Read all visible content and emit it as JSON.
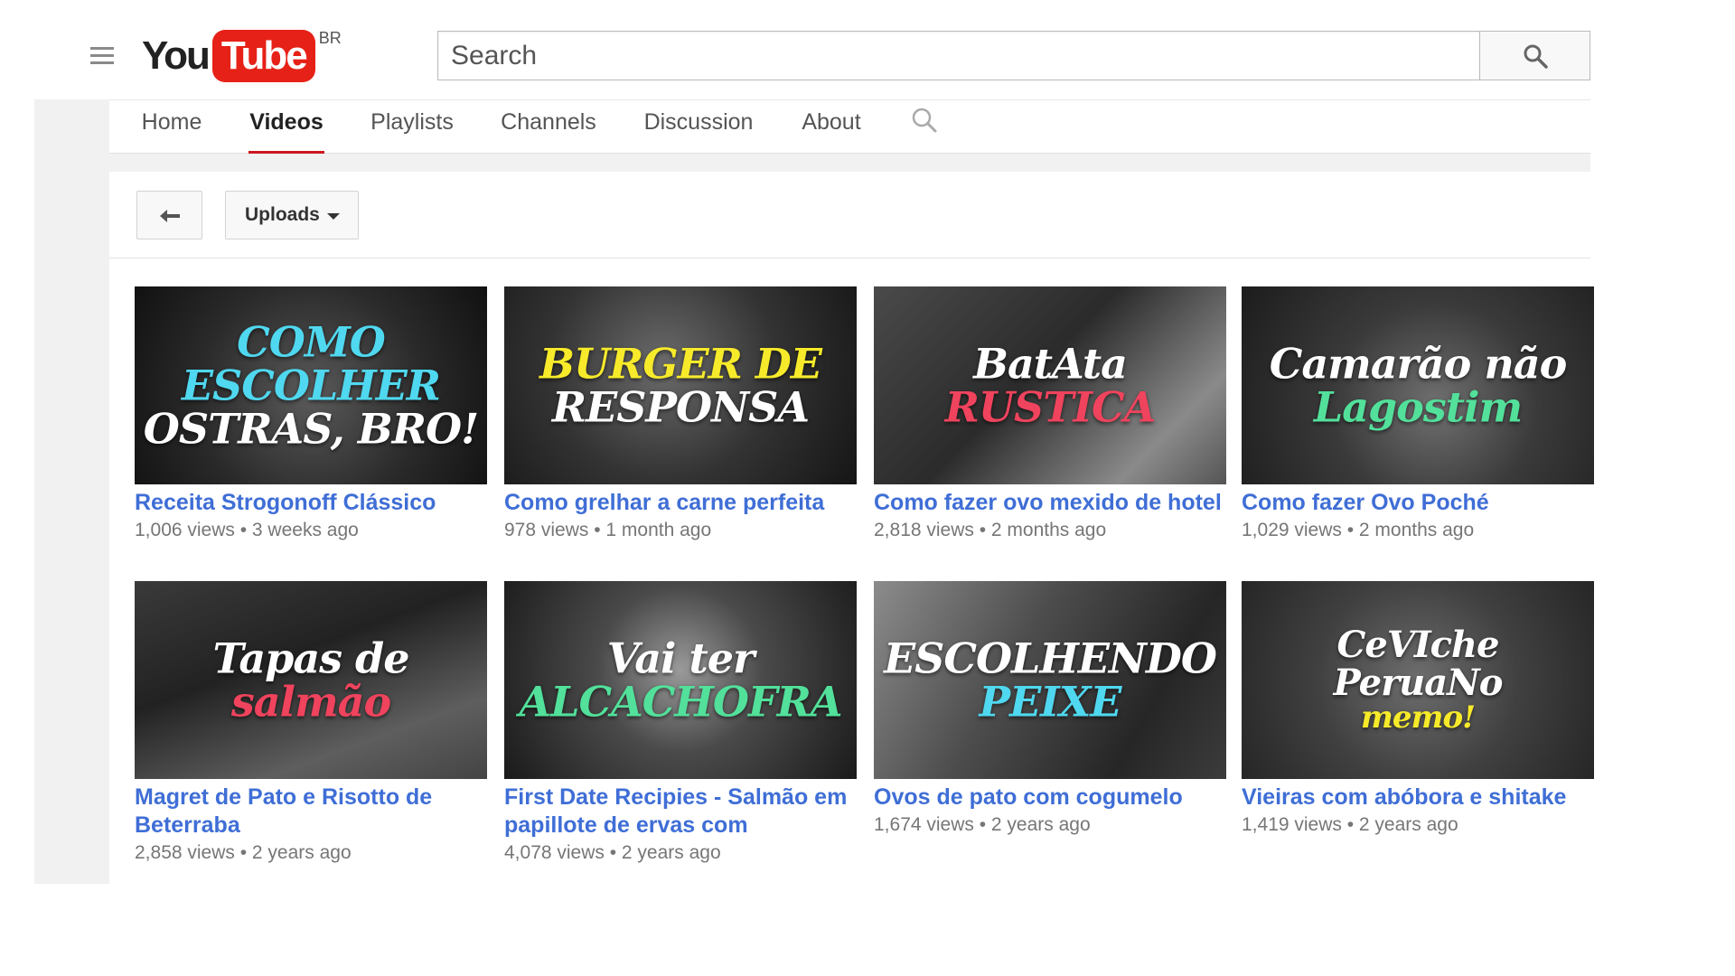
{
  "masthead": {
    "logo_you": "You",
    "logo_tube": "Tube",
    "country_code": "BR",
    "search_placeholder": "Search"
  },
  "tabs": [
    {
      "label": "Home",
      "active": false
    },
    {
      "label": "Videos",
      "active": true
    },
    {
      "label": "Playlists",
      "active": false
    },
    {
      "label": "Channels",
      "active": false
    },
    {
      "label": "Discussion",
      "active": false
    },
    {
      "label": "About",
      "active": false
    }
  ],
  "toolbar": {
    "back_icon": "back-arrow-icon",
    "uploads_label": "Uploads"
  },
  "colors": {
    "brand_red": "#e62117",
    "tab_underline": "#cc181e",
    "link_blue": "#3f6ed6",
    "meta_gray": "#767676"
  },
  "videos": [
    {
      "thumb_lines": [
        {
          "text": "COMO ESCOLHER",
          "color": "#4fd8ef"
        },
        {
          "text": "OSTRAS, BRO!",
          "color": "#ffffff"
        }
      ],
      "title": "Receita Strogonoff Clássico",
      "meta": "1,006 views  •  3 weeks ago"
    },
    {
      "thumb_lines": [
        {
          "text": "BURGER DE",
          "color": "#f7ea2a"
        },
        {
          "text": "RESPONSA",
          "color": "#ffffff"
        }
      ],
      "title": "Como grelhar a carne perfeita",
      "meta": "978 views  •  1 month ago"
    },
    {
      "thumb_lines": [
        {
          "text": "BatAta",
          "color": "#ffffff"
        },
        {
          "text": "RUSTICA",
          "color": "#f0435d"
        }
      ],
      "title": "Como fazer ovo mexido de hotel",
      "meta": "2,818 views  •  2 months ago"
    },
    {
      "thumb_lines": [
        {
          "text": "Camarão não",
          "color": "#ffffff"
        },
        {
          "text": "Lagostim",
          "color": "#52e09a"
        }
      ],
      "title": "Como fazer Ovo Poché",
      "meta": "1,029 views  •  2 months ago"
    },
    {
      "thumb_lines": [
        {
          "text": "Tapas de",
          "color": "#ffffff"
        },
        {
          "text": "salmão",
          "color": "#f0435d"
        }
      ],
      "title": "Magret de Pato e Risotto de Beterraba",
      "meta": "2,858 views  •  2 years ago"
    },
    {
      "thumb_lines": [
        {
          "text": "Vai ter",
          "color": "#ffffff"
        },
        {
          "text": "ALCACHOFRA",
          "color": "#52e09a"
        }
      ],
      "title": "First Date Recipies - Salmão em papillote de ervas com",
      "meta": "4,078 views  •  2 years ago"
    },
    {
      "thumb_lines": [
        {
          "text": "ESCOLHENDO",
          "color": "#ffffff"
        },
        {
          "text": "PEIXE",
          "color": "#4fd8ef"
        }
      ],
      "title": "Ovos de pato com cogumelo",
      "meta": "1,674 views  •  2 years ago"
    },
    {
      "thumb_lines": [
        {
          "text": "CeVIche",
          "color": "#ffffff"
        },
        {
          "text": "PeruaNo",
          "color": "#ffffff"
        },
        {
          "text": "memo!",
          "color": "#f7ea2a"
        }
      ],
      "title": "Vieiras com abóbora e shitake",
      "meta": "1,419 views  •  2 years ago"
    }
  ]
}
